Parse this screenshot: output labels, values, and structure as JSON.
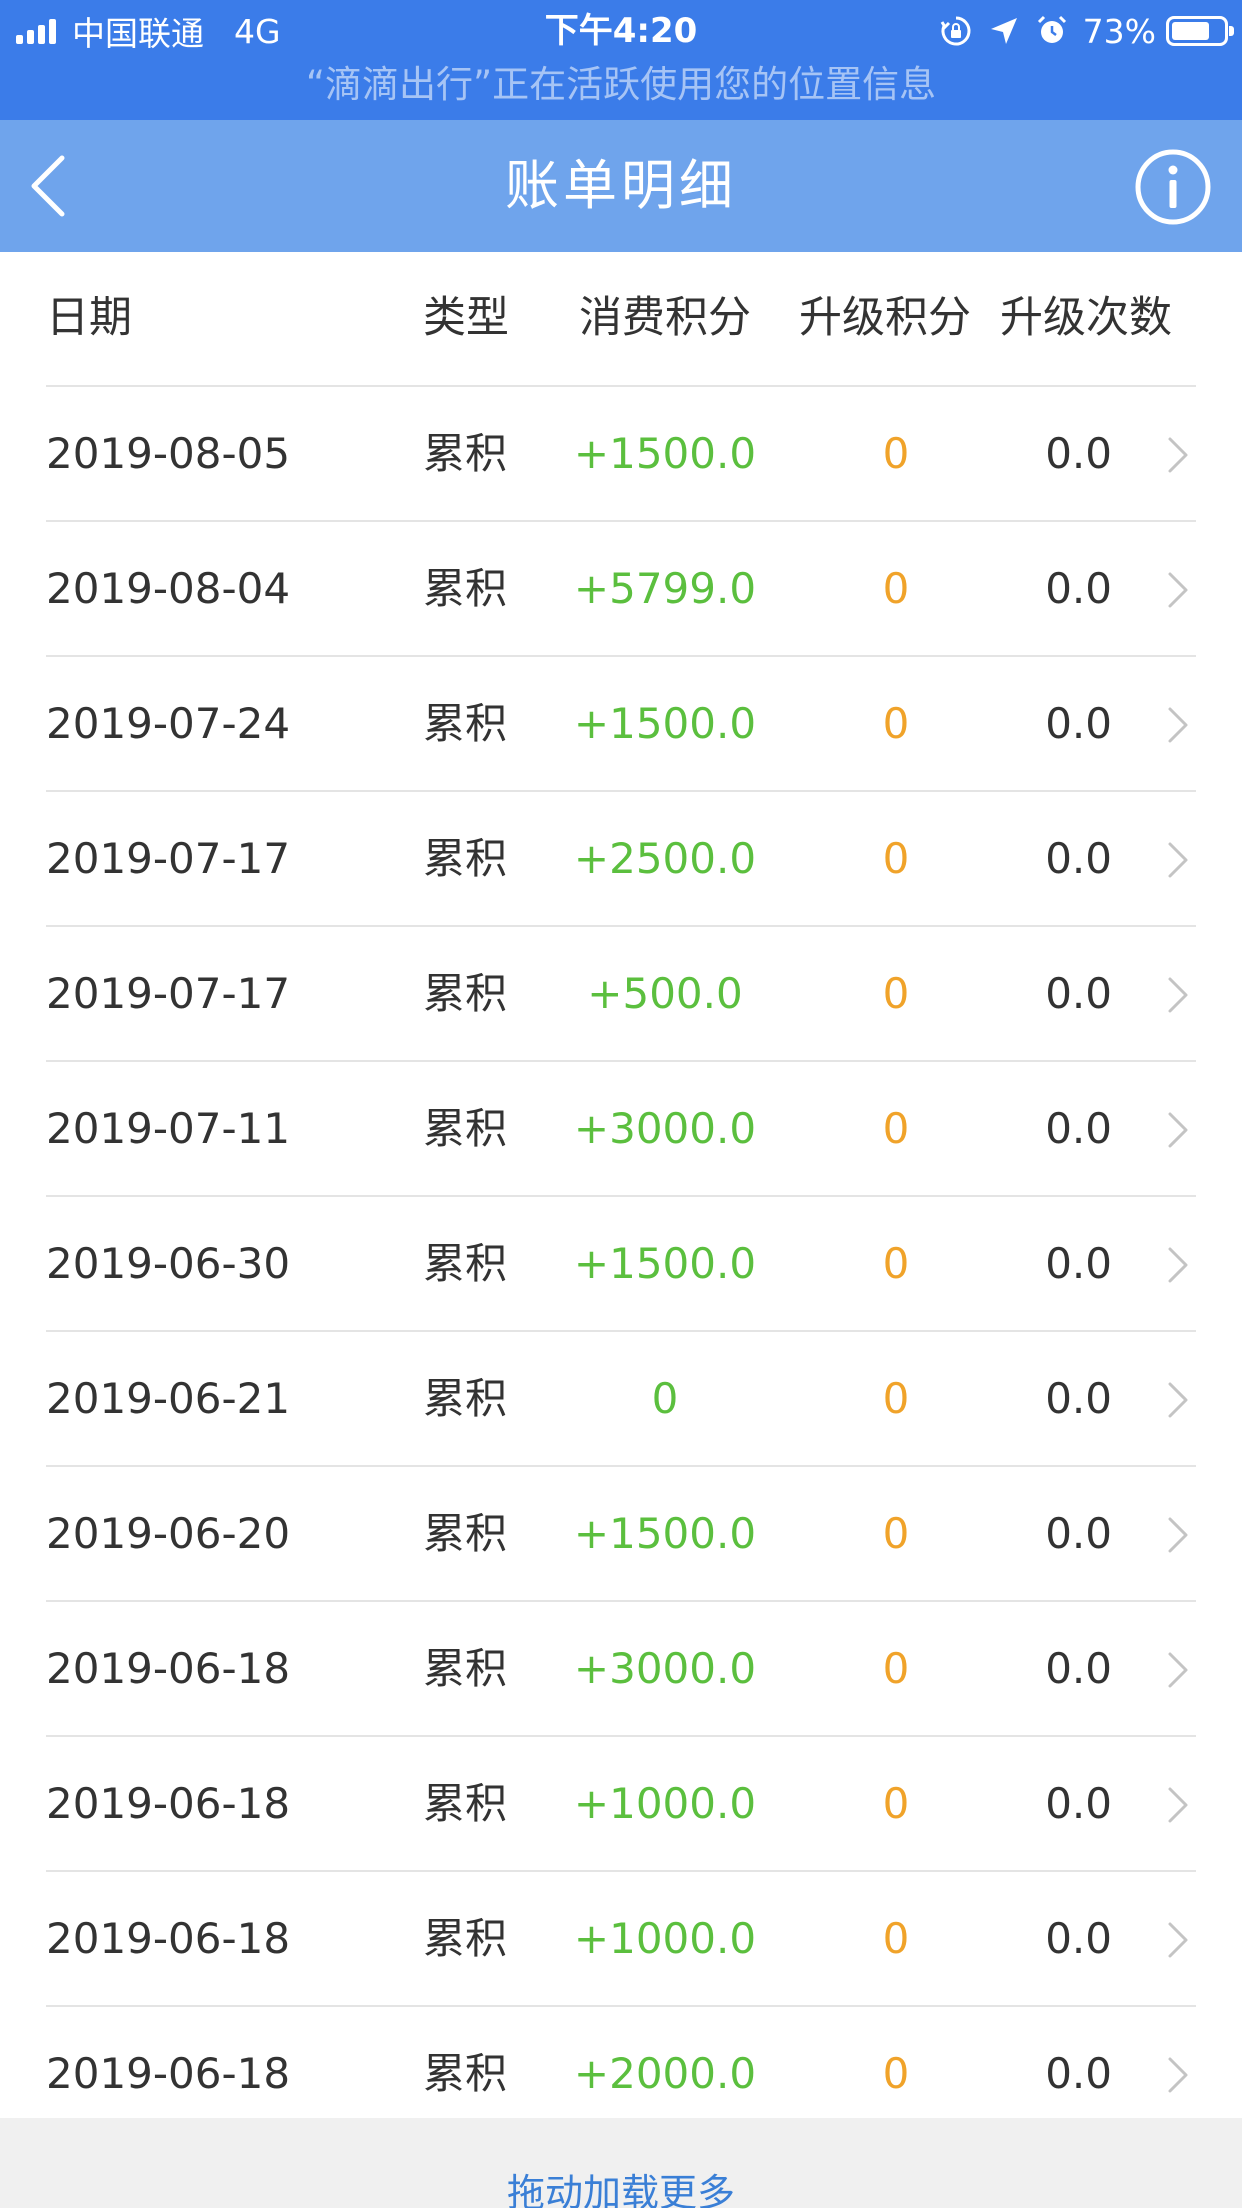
{
  "status_bar": {
    "carrier": "中国联通",
    "network": "4G",
    "time": "下午4:20",
    "battery": "73%",
    "battery_level": 0.73,
    "location_notice": "“滴滴出行”正在活跃使用您的位置信息"
  },
  "nav": {
    "title": "账单明细",
    "back_icon": "chevron-left-icon",
    "info_icon": "info-circle-icon"
  },
  "table": {
    "headers": {
      "date": "日期",
      "type": "类型",
      "consumption_points": "消费积分",
      "upgrade_points": "升级积分",
      "upgrade_count": "升级次数"
    },
    "rows": [
      {
        "date": "2019-08-05",
        "type": "累积",
        "consumption_points": "+1500.0",
        "upgrade_points": "0",
        "upgrade_count": "0.0"
      },
      {
        "date": "2019-08-04",
        "type": "累积",
        "consumption_points": "+5799.0",
        "upgrade_points": "0",
        "upgrade_count": "0.0"
      },
      {
        "date": "2019-07-24",
        "type": "累积",
        "consumption_points": "+1500.0",
        "upgrade_points": "0",
        "upgrade_count": "0.0"
      },
      {
        "date": "2019-07-17",
        "type": "累积",
        "consumption_points": "+2500.0",
        "upgrade_points": "0",
        "upgrade_count": "0.0"
      },
      {
        "date": "2019-07-17",
        "type": "累积",
        "consumption_points": "+500.0",
        "upgrade_points": "0",
        "upgrade_count": "0.0"
      },
      {
        "date": "2019-07-11",
        "type": "累积",
        "consumption_points": "+3000.0",
        "upgrade_points": "0",
        "upgrade_count": "0.0"
      },
      {
        "date": "2019-06-30",
        "type": "累积",
        "consumption_points": "+1500.0",
        "upgrade_points": "0",
        "upgrade_count": "0.0"
      },
      {
        "date": "2019-06-21",
        "type": "累积",
        "consumption_points": "0",
        "upgrade_points": "0",
        "upgrade_count": "0.0"
      },
      {
        "date": "2019-06-20",
        "type": "累积",
        "consumption_points": "+1500.0",
        "upgrade_points": "0",
        "upgrade_count": "0.0"
      },
      {
        "date": "2019-06-18",
        "type": "累积",
        "consumption_points": "+3000.0",
        "upgrade_points": "0",
        "upgrade_count": "0.0"
      },
      {
        "date": "2019-06-18",
        "type": "累积",
        "consumption_points": "+1000.0",
        "upgrade_points": "0",
        "upgrade_count": "0.0"
      },
      {
        "date": "2019-06-18",
        "type": "累积",
        "consumption_points": "+1000.0",
        "upgrade_points": "0",
        "upgrade_count": "0.0"
      },
      {
        "date": "2019-06-18",
        "type": "累积",
        "consumption_points": "+2000.0",
        "upgrade_points": "0",
        "upgrade_count": "0.0"
      }
    ]
  },
  "footer": {
    "load_more": "拖动加载更多"
  },
  "colors": {
    "status_bar_bg": "#3b7ce9",
    "nav_bg": "#6fa4ec",
    "consumption_green": "#5bbf3e",
    "upgrade_orange": "#f0a32a",
    "link_blue": "#3a7fd6"
  }
}
